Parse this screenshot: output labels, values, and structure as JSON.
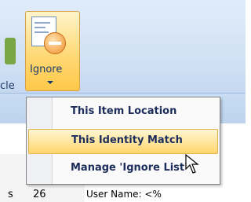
{
  "ribbon": {
    "prev_button_label": "cle",
    "ignore_button_label": "Ignore"
  },
  "menu": {
    "items": [
      {
        "label": "This Item Location",
        "highlighted": false
      },
      {
        "label": "This Identity Match",
        "highlighted": true
      },
      {
        "label": "Manage 'Ignore List'",
        "highlighted": false
      }
    ]
  },
  "background": {
    "left_text_1": "s",
    "left_text_2": "26",
    "user_name_text": "User Name: <%"
  },
  "colors": {
    "ribbon_bg": "#cfdff3",
    "highlight": "#ffd66e",
    "menu_text": "#1c2d5c"
  }
}
